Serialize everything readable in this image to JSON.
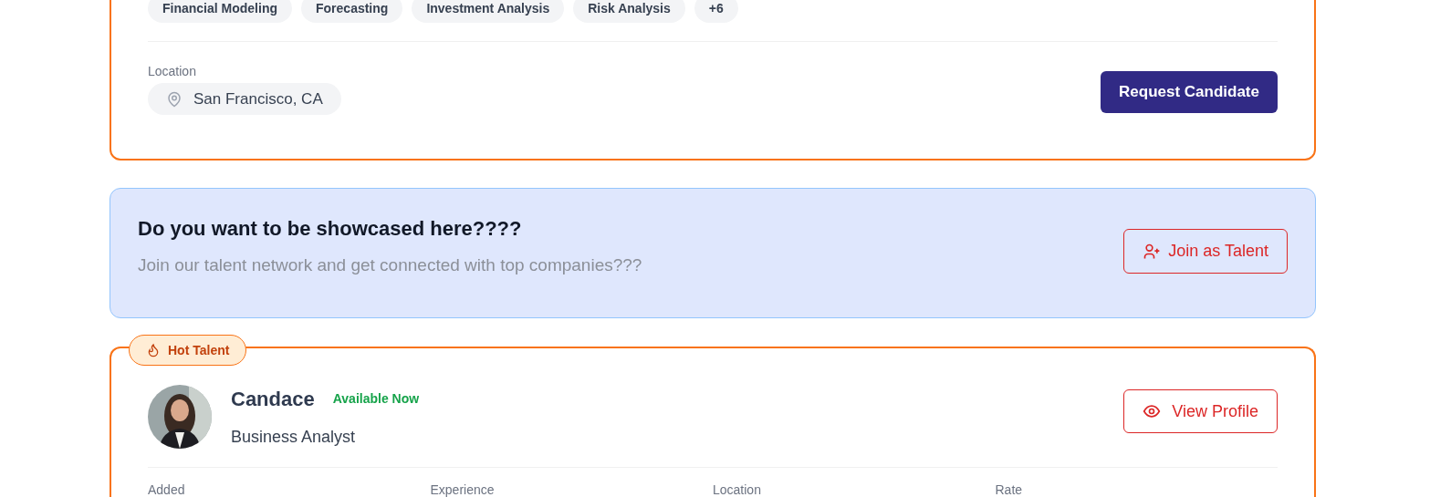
{
  "top_card": {
    "skills": [
      "Financial Modeling",
      "Forecasting",
      "Investment Analysis",
      "Risk Analysis",
      "+6"
    ],
    "location_label": "Location",
    "location": "San Francisco, CA",
    "button": "Request Candidate"
  },
  "banner": {
    "title": "Do you want to be showcased here????",
    "subtitle": "Join our talent network and get connected with top companies???",
    "button": "Join as Talent"
  },
  "talent_card": {
    "badge": "Hot Talent",
    "avatar": {
      "kind": "picture"
    },
    "name": "Candace",
    "status": "Available Now",
    "role": "Business Analyst",
    "button": "View Profile",
    "fields": [
      "Added",
      "Experience",
      "Location",
      "Rate"
    ]
  }
}
